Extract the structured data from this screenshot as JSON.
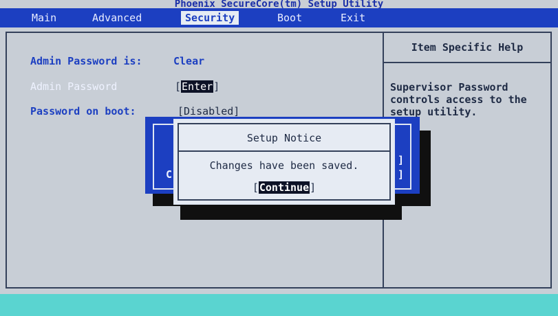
{
  "app": {
    "title": "Phoenix SecureCore(tm) Setup Utility"
  },
  "menu": {
    "items": [
      {
        "label": "Main"
      },
      {
        "label": "Advanced"
      },
      {
        "label": "Security"
      },
      {
        "label": "Boot"
      },
      {
        "label": "Exit"
      }
    ],
    "active": "Security"
  },
  "fields": {
    "admin_status_label": "Admin Password is:",
    "admin_status_value": "Clear",
    "admin_password_label": "Admin Password",
    "admin_password_value": "Enter",
    "password_on_boot_label": "Password on boot:",
    "password_on_boot_value": "[Disabled]"
  },
  "help": {
    "title": "Item Specific Help",
    "text": "Supervisor Password\ncontrols access to the\nsetup utility."
  },
  "background_popup": {
    "left_fragment": "C",
    "right_fragment_1": "]",
    "right_fragment_2": "]"
  },
  "dialog": {
    "title": "Setup Notice",
    "message": "Changes have been saved.",
    "button_label": "Continue"
  },
  "colors": {
    "menu_bar": "#1c3fc1",
    "panel_background": "#c8ced6",
    "text_blue": "#1c3fc1",
    "highlight": "#0d1226",
    "footer": "#5ad4d0"
  }
}
